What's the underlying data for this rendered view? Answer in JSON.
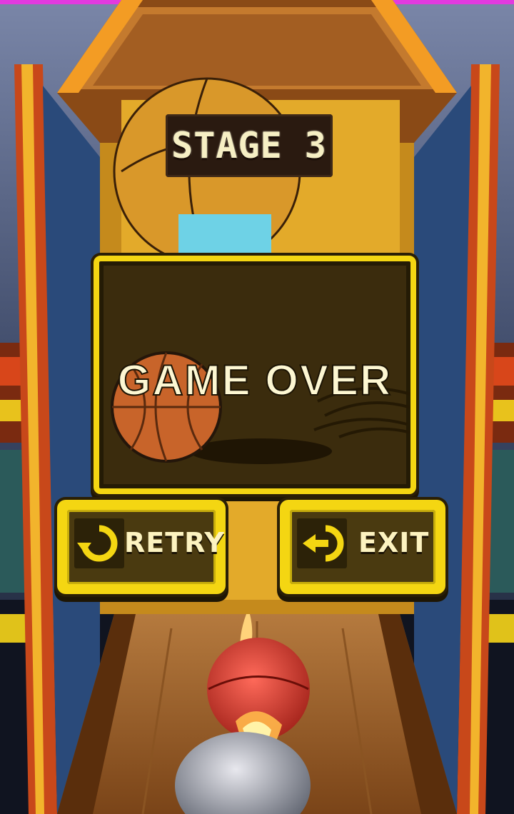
{
  "stage": {
    "label": "STAGE 3"
  },
  "game_over": {
    "title": "GAME OVER"
  },
  "buttons": {
    "retry": {
      "label": "RETRY",
      "icon": "retry-icon"
    },
    "exit": {
      "label": "EXIT",
      "icon": "exit-icon"
    }
  },
  "colors": {
    "panel_border": "#f4d612",
    "panel_fill": "#3b2c0d",
    "text_cream": "#fdf7d2",
    "ball_orange": "#c8642a"
  }
}
